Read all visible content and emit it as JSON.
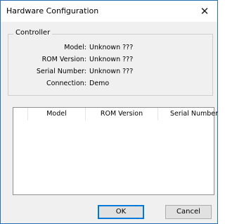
{
  "window": {
    "title": "Hardware Configuration",
    "close_symbol": "✕"
  },
  "controller": {
    "group_label": "Controller",
    "fields": [
      {
        "label": "Model:",
        "value": "Unknown ???"
      },
      {
        "label": "ROM Version:",
        "value": "Unknown ???"
      },
      {
        "label": "Serial Number:",
        "value": "Unknown ???"
      },
      {
        "label": "Connection:",
        "value": "Demo"
      }
    ]
  },
  "list": {
    "columns": [
      "",
      "Model",
      "ROM Version",
      "Serial Number"
    ],
    "rows": []
  },
  "buttons": {
    "ok_label": "OK",
    "cancel_label": "Cancel"
  }
}
